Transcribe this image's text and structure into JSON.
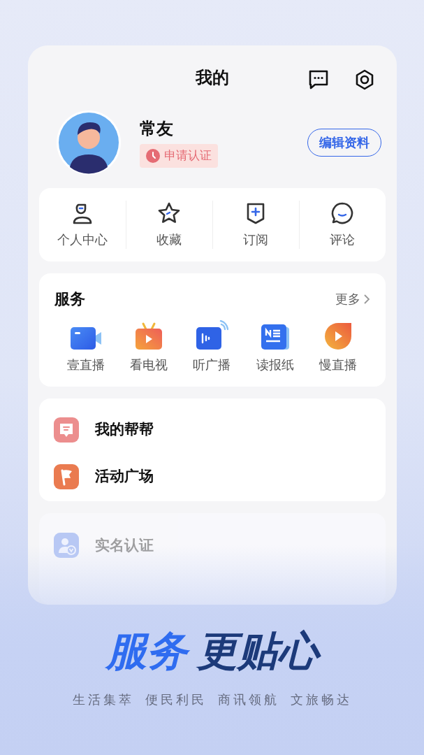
{
  "header": {
    "title": "我的"
  },
  "profile": {
    "name": "常友",
    "badge": "申请认证",
    "edit_button": "编辑资料"
  },
  "quick_actions": [
    {
      "label": "个人中心",
      "kind": "person"
    },
    {
      "label": "收藏",
      "kind": "star"
    },
    {
      "label": "订阅",
      "kind": "subscribe"
    },
    {
      "label": "评论",
      "kind": "comment"
    }
  ],
  "services": {
    "title": "服务",
    "more": "更多",
    "items": [
      {
        "label": "壹直播",
        "kind": "camera"
      },
      {
        "label": "看电视",
        "kind": "tv"
      },
      {
        "label": "听广播",
        "kind": "radio"
      },
      {
        "label": "读报纸",
        "kind": "newspaper"
      },
      {
        "label": "慢直播",
        "kind": "slow"
      }
    ]
  },
  "menu": [
    {
      "label": "我的帮帮",
      "kind": "help"
    },
    {
      "label": "活动广场",
      "kind": "flag"
    }
  ],
  "faded_menu": [
    {
      "label": "实名认证",
      "kind": "verify"
    }
  ],
  "slogan": {
    "highlight": "服务",
    "rest": "更贴心"
  },
  "tagline": [
    "生活集萃",
    "便民利民",
    "商讯领航",
    "文旅畅达"
  ]
}
